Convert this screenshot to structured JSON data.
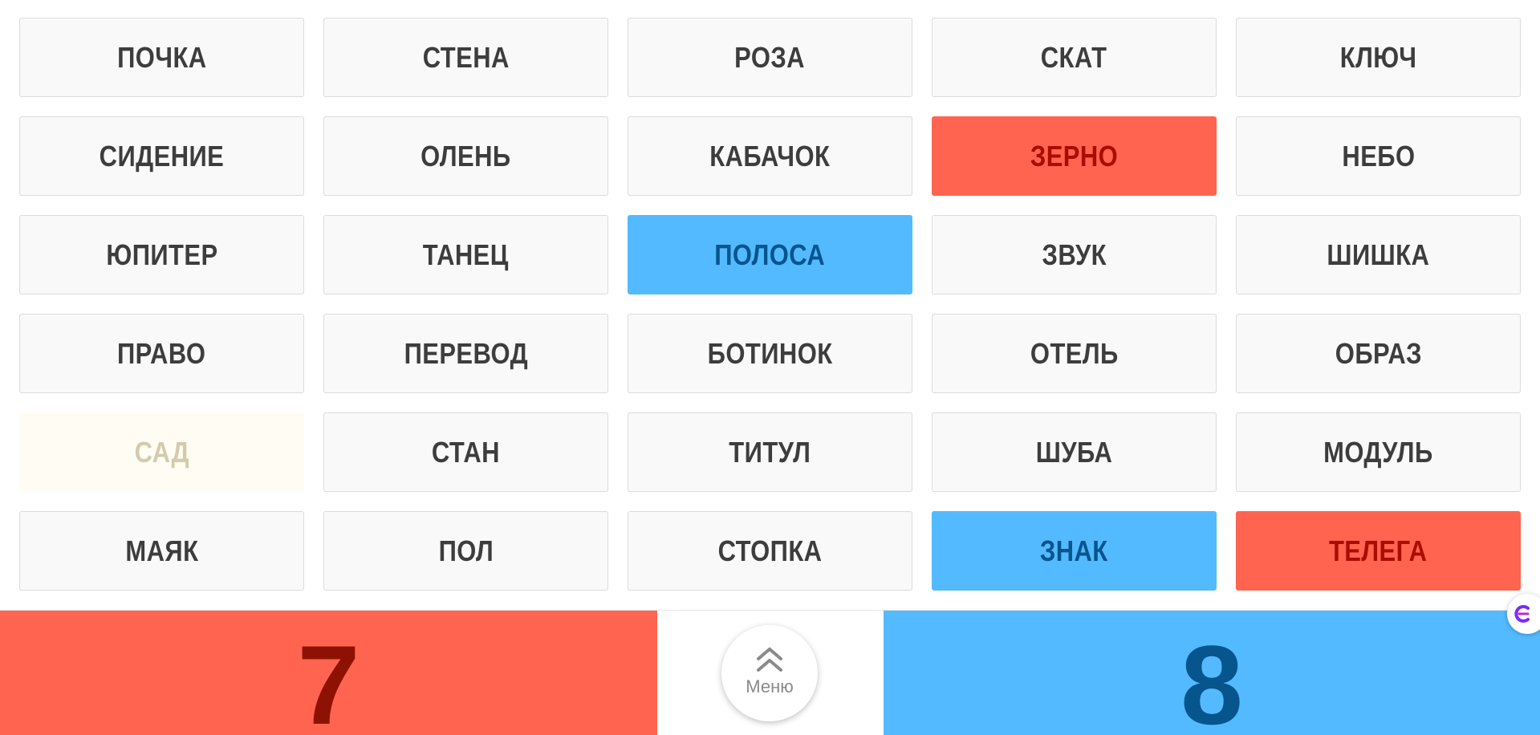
{
  "board": {
    "cards": [
      {
        "word": "ПОЧКА",
        "state": "neutral"
      },
      {
        "word": "СТЕНА",
        "state": "neutral"
      },
      {
        "word": "РОЗА",
        "state": "neutral"
      },
      {
        "word": "СКАТ",
        "state": "neutral"
      },
      {
        "word": "КЛЮЧ",
        "state": "neutral"
      },
      {
        "word": "СИДЕНИЕ",
        "state": "neutral"
      },
      {
        "word": "ОЛЕНЬ",
        "state": "neutral"
      },
      {
        "word": "КАБАЧОК",
        "state": "neutral"
      },
      {
        "word": "ЗЕРНО",
        "state": "red"
      },
      {
        "word": "НЕБО",
        "state": "neutral"
      },
      {
        "word": "ЮПИТЕР",
        "state": "neutral"
      },
      {
        "word": "ТАНЕЦ",
        "state": "neutral"
      },
      {
        "word": "ПОЛОСА",
        "state": "blue"
      },
      {
        "word": "ЗВУК",
        "state": "neutral"
      },
      {
        "word": "ШИШКА",
        "state": "neutral"
      },
      {
        "word": "ПРАВО",
        "state": "neutral"
      },
      {
        "word": "ПЕРЕВОД",
        "state": "neutral"
      },
      {
        "word": "БОТИНОК",
        "state": "neutral"
      },
      {
        "word": "ОТЕЛЬ",
        "state": "neutral"
      },
      {
        "word": "ОБРАЗ",
        "state": "neutral"
      },
      {
        "word": "САД",
        "state": "beige"
      },
      {
        "word": "СТАН",
        "state": "neutral"
      },
      {
        "word": "ТИТУЛ",
        "state": "neutral"
      },
      {
        "word": "ШУБА",
        "state": "neutral"
      },
      {
        "word": "МОДУЛЬ",
        "state": "neutral"
      },
      {
        "word": "МАЯК",
        "state": "neutral"
      },
      {
        "word": "ПОЛ",
        "state": "neutral"
      },
      {
        "word": "СТОПКА",
        "state": "neutral"
      },
      {
        "word": "ЗНАК",
        "state": "blue"
      },
      {
        "word": "ТЕЛЕГА",
        "state": "red"
      }
    ]
  },
  "score": {
    "red": "7",
    "blue": "8"
  },
  "menu": {
    "label": "Меню",
    "icon": "double-chevron-up-icon"
  },
  "side_widget": {
    "icon": "assistant-icon"
  },
  "colors": {
    "red_team": "#ff6450",
    "red_text": "#a80d00",
    "blue_team": "#53baff",
    "blue_text": "#06558d",
    "neutral_card": "#f9f9f9",
    "beige_card": "#fffdf3"
  }
}
